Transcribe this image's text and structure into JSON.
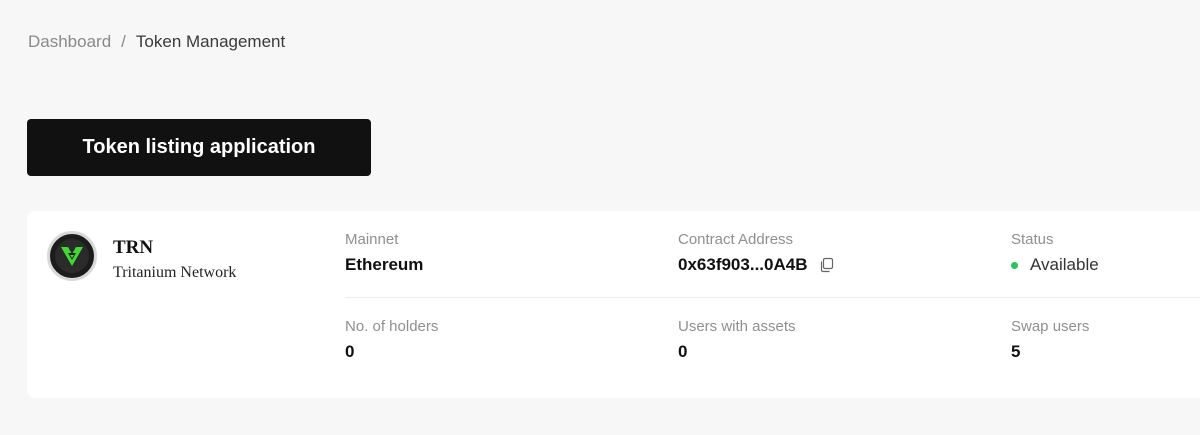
{
  "breadcrumb": {
    "home": "Dashboard",
    "separator": "/",
    "current": "Token Management"
  },
  "actions": {
    "apply_label": "Token listing application"
  },
  "token": {
    "symbol": "TRN",
    "name": "Tritanium Network",
    "logo_icon": "tritanium-logo-icon",
    "accent_color": "#3ddc2f"
  },
  "details": {
    "mainnet": {
      "label": "Mainnet",
      "value": "Ethereum"
    },
    "contract": {
      "label": "Contract Address",
      "value": "0x63f903...0A4B",
      "icon": "copy-icon"
    },
    "status": {
      "label": "Status",
      "value": "Available",
      "color": "#22c55e"
    },
    "holders": {
      "label": "No. of holders",
      "value": "0"
    },
    "users_with_assets": {
      "label": "Users with assets",
      "value": "0"
    },
    "swap_users": {
      "label": "Swap users",
      "value": "5"
    }
  }
}
